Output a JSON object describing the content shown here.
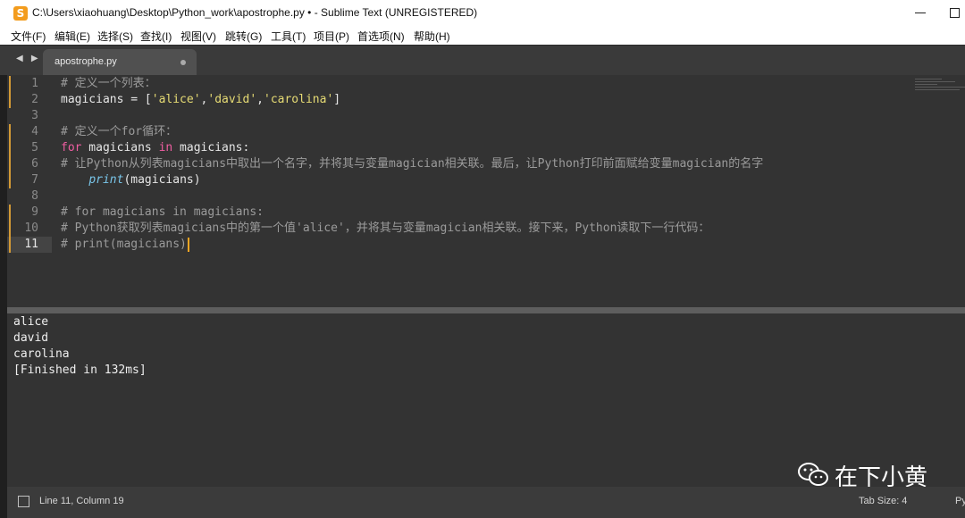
{
  "window": {
    "title": "C:\\Users\\xiaohuang\\Desktop\\Python_work\\apostrophe.py • - Sublime Text (UNREGISTERED)",
    "app_icon": "S"
  },
  "menu": [
    "文件(F)",
    "编辑(E)",
    "选择(S)",
    "查找(I)",
    "视图(V)",
    "跳转(G)",
    "工具(T)",
    "项目(P)",
    "首选项(N)",
    "帮助(H)"
  ],
  "tab": {
    "label": "apostrophe.py",
    "modified": true
  },
  "nav": {
    "arrows": "◀ ▶"
  },
  "editor": {
    "line_numbers": [
      "1",
      "2",
      "3",
      "4",
      "5",
      "6",
      "7",
      "8",
      "9",
      "10",
      "11"
    ],
    "current_line": 11,
    "lines": {
      "l1": "# 定义一个列表：",
      "l2": [
        "magicians = [",
        "'alice'",
        ",",
        "'david'",
        ",",
        "'carolina'",
        "]"
      ],
      "l4": "# 定义一个for循环：",
      "l5": [
        "for",
        " magicians ",
        "in",
        " magicians:"
      ],
      "l6": "# 让Python从列表magicians中取出一个名字，并将其与变量magician相关联。最后，让Python打印前面赋给变量magician的名字",
      "l7": [
        "    ",
        "print",
        "(magicians)"
      ],
      "l9": "# for magicians in magicians:",
      "l10": "# Python获取列表magicians中的第一个值'alice'，并将其与变量magician相关联。接下来，Python读取下一行代码：",
      "l11": "# print(magicians)"
    }
  },
  "output": {
    "lines": [
      "alice",
      "david",
      "carolina",
      "[Finished in 132ms]"
    ]
  },
  "watermark": {
    "text": "在下小黄",
    "icon": "wechat-icon"
  },
  "status": {
    "position": "Line 11, Column 19",
    "tab_size": "Tab Size: 4",
    "syntax": "Py"
  },
  "colors": {
    "accent": "#f39c1d",
    "keyword": "#ee5ea1",
    "string": "#e6db74",
    "function": "#79c6ea",
    "comment": "#9b9b9b",
    "caret": "#f5a623"
  }
}
